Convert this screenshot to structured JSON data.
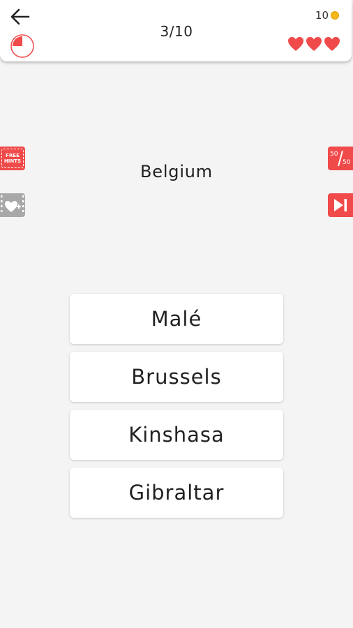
{
  "header": {
    "progress": "3/10",
    "coins": "10",
    "lives": 3,
    "timer_fraction": 0.25,
    "accent_color": "#f04a4a"
  },
  "hints": {
    "free_hints_line1": "FREE",
    "free_hints_line2": "HINTS",
    "fifty_top": "50",
    "fifty_bottom": "50"
  },
  "question": "Belgium",
  "answers": [
    {
      "label": "Malé"
    },
    {
      "label": "Brussels"
    },
    {
      "label": "Kinshasa"
    },
    {
      "label": "Gibraltar"
    }
  ],
  "icons": {
    "back": "arrow-left-icon",
    "timer": "timer-icon",
    "coin": "coin-icon",
    "heart": "heart-icon",
    "video_life": "video-heart-icon",
    "skip": "skip-icon"
  }
}
